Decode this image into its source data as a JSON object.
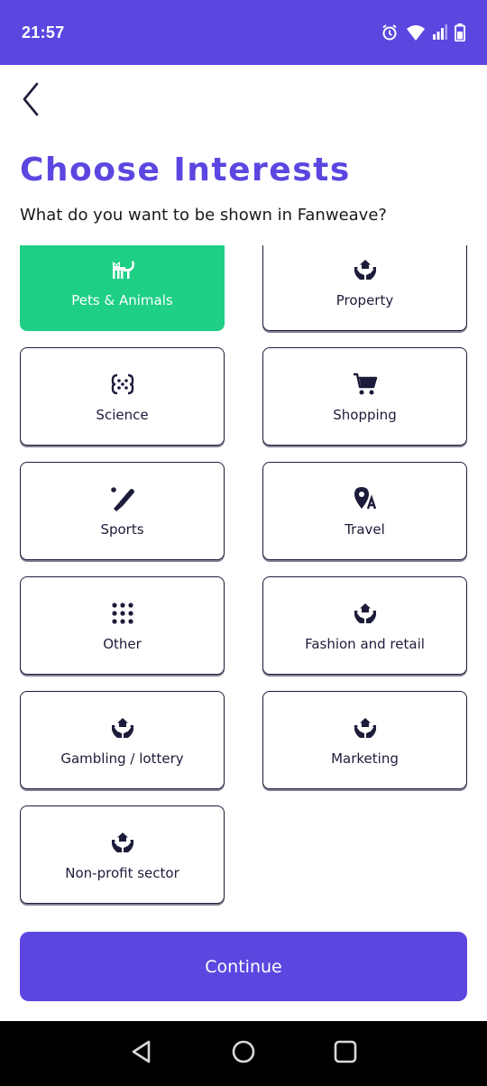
{
  "status_bar": {
    "time": "21:57",
    "icons": [
      "alarm-icon",
      "wifi-icon",
      "signal-icon",
      "battery-icon"
    ]
  },
  "header": {
    "back_icon": "chevron-left-icon",
    "title": "Choose Interests",
    "subtitle": "What do you want to be shown in Fanweave?"
  },
  "interests": [
    {
      "label": "Pets & Animals",
      "icon": "cat-icon",
      "selected": true
    },
    {
      "label": "Property",
      "icon": "hands-house-icon",
      "selected": false
    },
    {
      "label": "Science",
      "icon": "science-icon",
      "selected": false
    },
    {
      "label": "Shopping",
      "icon": "cart-icon",
      "selected": false
    },
    {
      "label": "Sports",
      "icon": "cricket-bat-icon",
      "selected": false
    },
    {
      "label": "Travel",
      "icon": "location-pin-icon",
      "selected": false
    },
    {
      "label": "Other",
      "icon": "dots-grid-icon",
      "selected": false
    },
    {
      "label": "Fashion and retail",
      "icon": "hands-house-icon",
      "selected": false
    },
    {
      "label": "Gambling / lottery",
      "icon": "hands-house-icon",
      "selected": false
    },
    {
      "label": "Marketing",
      "icon": "hands-house-icon",
      "selected": false
    },
    {
      "label": "Non-profit sector",
      "icon": "hands-house-icon",
      "selected": false
    }
  ],
  "continue_label": "Continue",
  "colors": {
    "primary": "#5b47e0",
    "selected": "#1ecf85",
    "dark": "#1c1c3a"
  }
}
